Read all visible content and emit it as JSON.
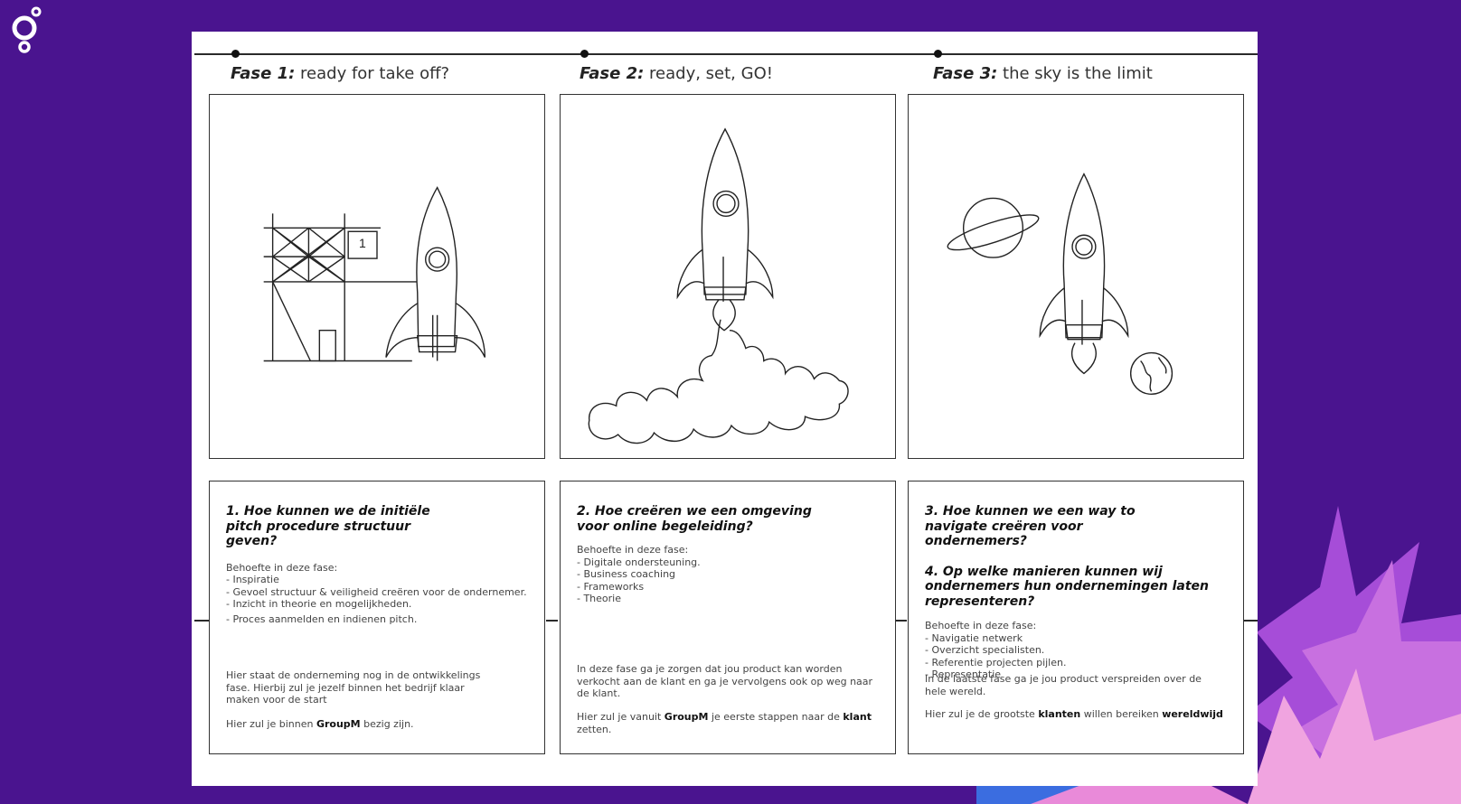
{
  "colors": {
    "background": "#4a148f",
    "sheet": "#ffffff",
    "accent_pink": "#e98ad9",
    "accent_violet": "#a64dd8"
  },
  "logo": {
    "icon": "brand-logo-icon"
  },
  "phases": [
    {
      "title_bold": "Fase 1:",
      "title_rest": "ready for take off?",
      "illustration": "rocket-on-launch-tower",
      "tower_sign": "1",
      "questions": [
        "1. Hoe kunnen we de initiële pitch procedure structuur geven?"
      ],
      "needs_label": "Behoefte in deze fase:",
      "needs": [
        "- Inspiratie",
        "- Gevoel structuur & veiligheid creëren voor de ondernemer.",
        "- Inzicht in theorie en mogelijkheden.",
        "- Proces aanmelden en indienen pitch."
      ],
      "para1": "Hier staat de onderneming nog in de ontwikkelings fase. Hierbij zul je jezelf binnen het bedrijf klaar maken voor de start",
      "para2_pre": "Hier zul je binnen ",
      "para2_b1": "GroupM",
      "para2_mid": " bezig zijn.",
      "para2_b2": "",
      "para2_post": ""
    },
    {
      "title_bold": "Fase 2:",
      "title_rest": "ready, set, GO!",
      "illustration": "rocket-launching-with-smoke",
      "questions": [
        "2. Hoe creëren we een omgeving voor online begeleiding?"
      ],
      "needs_label": "Behoefte in deze fase:",
      "needs": [
        "- Digitale ondersteuning.",
        "- Business coaching",
        "- Frameworks",
        "- Theorie"
      ],
      "para1": "In deze fase ga je zorgen dat jou product kan worden verkocht aan de klant en ga je vervolgens ook op weg naar de klant.",
      "para2_pre": "Hier zul je vanuit ",
      "para2_b1": "GroupM",
      "para2_mid": " je eerste stappen naar de ",
      "para2_b2": "klant",
      "para2_post": " zetten."
    },
    {
      "title_bold": "Fase 3:",
      "title_rest": "the sky is the limit",
      "illustration": "rocket-in-space-with-planets",
      "questions": [
        "3. Hoe kunnen we een way to navigate creëren voor ondernemers?",
        "4. Op welke manieren kunnen wij ondernemers hun ondernemingen laten representeren?"
      ],
      "needs_label": "Behoefte in deze fase:",
      "needs": [
        "- Navigatie netwerk",
        "- Overzicht specialisten.",
        "- Referentie projecten pijlen.",
        "- Representatie"
      ],
      "para1": "In de laatste fase ga je jou product verspreiden over de hele wereld.",
      "para2_pre": "Hier zul je de grootste ",
      "para2_b1": "klanten",
      "para2_mid": " willen bereiken ",
      "para2_b2": "wereldwijd",
      "para2_post": ""
    }
  ]
}
